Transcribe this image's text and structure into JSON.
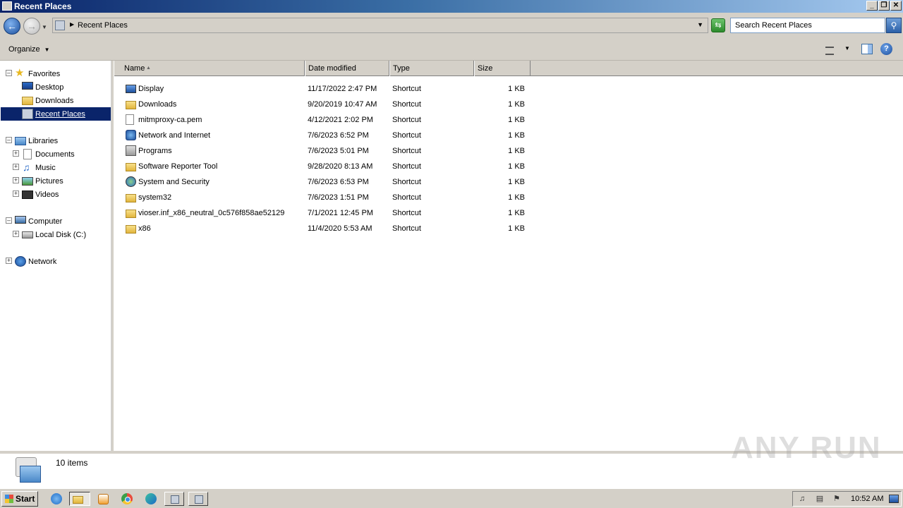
{
  "window": {
    "title": "Recent Places",
    "controls": {
      "minimize": "_",
      "maximize": "❐",
      "close": "✕"
    }
  },
  "address": {
    "path": "Recent Places",
    "search_placeholder": "Search Recent Places"
  },
  "toolbar": {
    "organize_label": "Organize"
  },
  "nav": {
    "favorites": {
      "label": "Favorites",
      "items": [
        {
          "label": "Desktop",
          "icon": "desktop-icon"
        },
        {
          "label": "Downloads",
          "icon": "downloads-folder-icon"
        },
        {
          "label": "Recent Places",
          "icon": "recent-places-icon",
          "selected": true
        }
      ]
    },
    "libraries": {
      "label": "Libraries",
      "items": [
        {
          "label": "Documents",
          "icon": "documents-icon"
        },
        {
          "label": "Music",
          "icon": "music-icon"
        },
        {
          "label": "Pictures",
          "icon": "pictures-icon"
        },
        {
          "label": "Videos",
          "icon": "videos-icon"
        }
      ]
    },
    "computer": {
      "label": "Computer",
      "items": [
        {
          "label": "Local Disk (C:)",
          "icon": "disk-icon"
        }
      ]
    },
    "network": {
      "label": "Network"
    }
  },
  "columns": {
    "name": "Name",
    "date": "Date modified",
    "type": "Type",
    "size": "Size"
  },
  "files": [
    {
      "name": "Display",
      "date": "11/17/2022 2:47 PM",
      "type": "Shortcut",
      "size": "1 KB",
      "icon": "display-icon"
    },
    {
      "name": "Downloads",
      "date": "9/20/2019 10:47 AM",
      "type": "Shortcut",
      "size": "1 KB",
      "icon": "folder-icon"
    },
    {
      "name": "mitmproxy-ca.pem",
      "date": "4/12/2021 2:02 PM",
      "type": "Shortcut",
      "size": "1 KB",
      "icon": "document-icon"
    },
    {
      "name": "Network and Internet",
      "date": "7/6/2023 6:52 PM",
      "type": "Shortcut",
      "size": "1 KB",
      "icon": "network-icon"
    },
    {
      "name": "Programs",
      "date": "7/6/2023 5:01 PM",
      "type": "Shortcut",
      "size": "1 KB",
      "icon": "programs-icon"
    },
    {
      "name": "Software Reporter Tool",
      "date": "9/28/2020 8:13 AM",
      "type": "Shortcut",
      "size": "1 KB",
      "icon": "folder-icon"
    },
    {
      "name": "System and Security",
      "date": "7/6/2023 6:53 PM",
      "type": "Shortcut",
      "size": "1 KB",
      "icon": "security-icon"
    },
    {
      "name": "system32",
      "date": "7/6/2023 1:51 PM",
      "type": "Shortcut",
      "size": "1 KB",
      "icon": "folder-icon"
    },
    {
      "name": "vioser.inf_x86_neutral_0c576f858ae52129",
      "date": "7/1/2021 12:45 PM",
      "type": "Shortcut",
      "size": "1 KB",
      "icon": "folder-icon"
    },
    {
      "name": "x86",
      "date": "11/4/2020 5:53 AM",
      "type": "Shortcut",
      "size": "1 KB",
      "icon": "folder-icon"
    }
  ],
  "details": {
    "count": "10 items"
  },
  "watermark": "ANY RUN",
  "taskbar": {
    "start_label": "Start",
    "clock": "10:52 AM"
  }
}
